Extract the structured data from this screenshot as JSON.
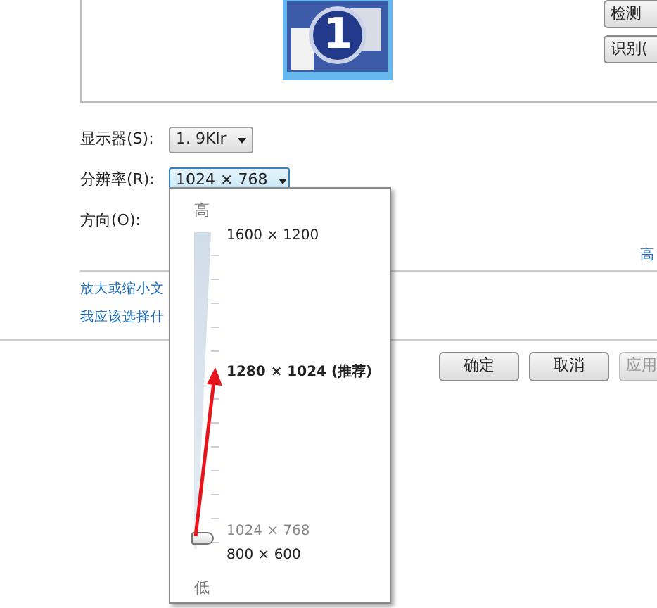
{
  "preview": {
    "display_number": "1",
    "buttons": [
      {
        "label": "检测"
      },
      {
        "label": "识别("
      }
    ]
  },
  "fields": [
    {
      "label": "显示器(S):",
      "value": "1. 9Klr",
      "expanded": false
    },
    {
      "label": "分辨率(R):",
      "value": "1024 × 768",
      "expanded": true
    },
    {
      "label": "方向(O):"
    }
  ],
  "resolution_popup": {
    "high_label": "高",
    "low_label": "低",
    "level": 0.03,
    "options": [
      {
        "label": "1600 × 1200",
        "selected": false,
        "recommended": false
      },
      {
        "label": "1280 × 1024 (推荐)",
        "selected": false,
        "recommended": true
      },
      {
        "label": "1024 × 768",
        "selected": true,
        "recommended": false
      },
      {
        "label": "800 × 600",
        "selected": false,
        "recommended": false
      }
    ]
  },
  "advanced_link": "高",
  "links": [
    "放大或缩小文",
    "我应该选择什"
  ],
  "buttons": [
    {
      "label": "确定",
      "disabled": false
    },
    {
      "label": "取消",
      "disabled": false
    },
    {
      "label": "应用",
      "disabled": true
    }
  ]
}
